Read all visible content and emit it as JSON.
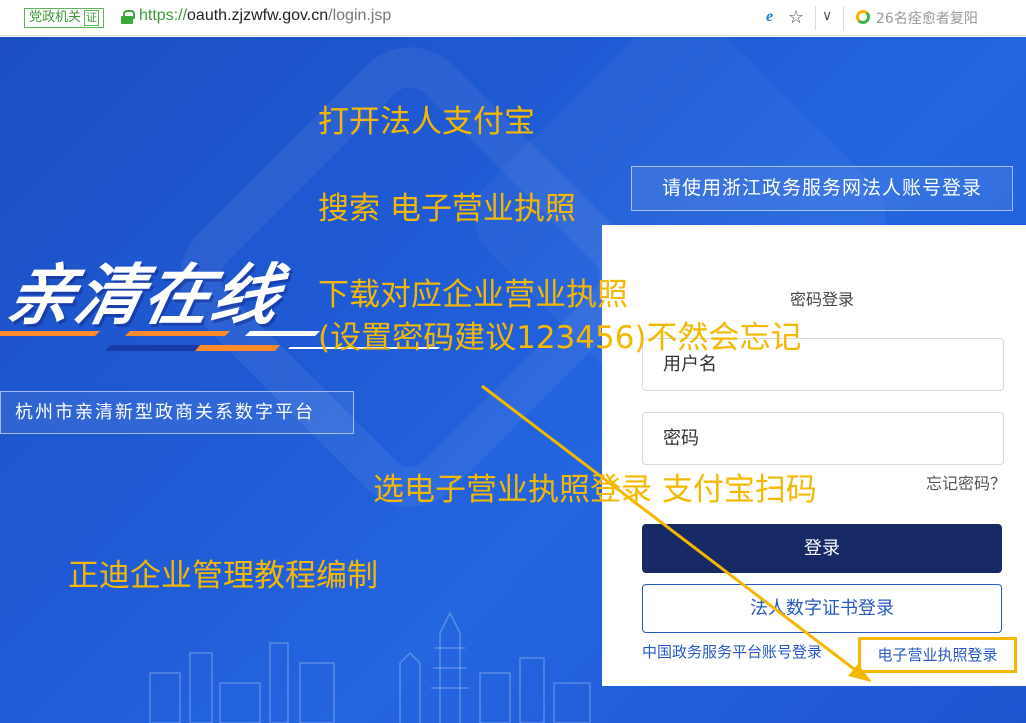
{
  "browser": {
    "gov_badge": "党政机关",
    "cert_mark": "证",
    "url_proto": "https://",
    "url_host": "oauth.zjzwfw.gov.cn",
    "url_path": "/login.jsp",
    "news_text": "26名痊愈者复阳",
    "icons": [
      "ie-icon",
      "star-icon",
      "chevron-down-icon",
      "search-icon",
      "lock-icon"
    ]
  },
  "hero": {
    "logo": "亲清在线",
    "platform_name": "杭州市亲清新型政商关系数字平台",
    "hint": "请使用浙江政务服务网法人账号登录"
  },
  "login": {
    "tab": "密码登录",
    "username_placeholder": "用户名",
    "password_placeholder": "密码",
    "forgot": "忘记密码？",
    "submit": "登录",
    "cert_login": "法人数字证书登录",
    "cn_platform_link": "中国政务服务平台账号登录",
    "license_link": "电子营业执照登录"
  },
  "annotations": {
    "step1": "打开法人支付宝",
    "step2": "搜索 电子营业执照",
    "step3": "下载对应企业营业执照",
    "step4": "(设置密码建议123456)不然会忘记",
    "step5": "选电子营业执照登录 支付宝扫码",
    "credit": "正迪企业管理教程编制"
  },
  "colors": {
    "hero_blue": "#1f5cd6",
    "annotation_yellow": "#f5b800",
    "login_button": "#172a66",
    "link_blue": "#2659c4"
  }
}
